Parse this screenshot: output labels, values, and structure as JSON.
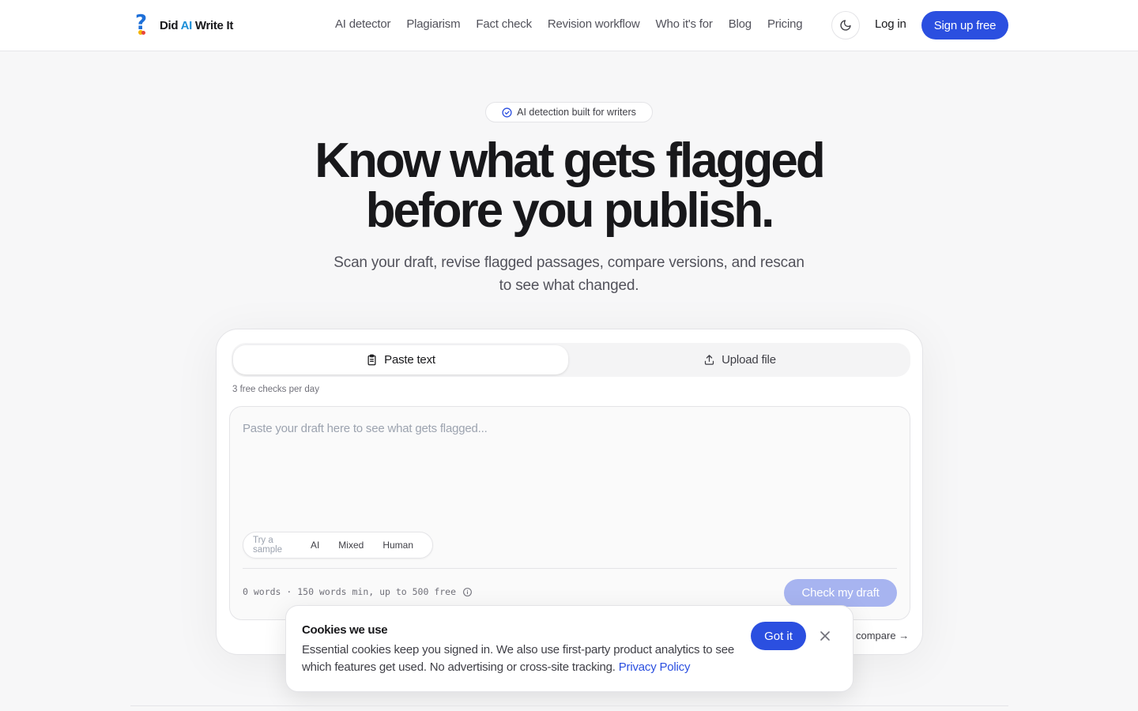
{
  "header": {
    "logo": {
      "part1": "Did ",
      "part2": "AI",
      "part3": " Write It"
    },
    "nav": [
      "AI detector",
      "Plagiarism",
      "Fact check",
      "Revision workflow",
      "Who it's for",
      "Blog",
      "Pricing"
    ],
    "theme_icon": "moon-icon",
    "login_label": "Log in",
    "signup_label": "Sign up free"
  },
  "hero": {
    "badge": "AI detection built for writers",
    "title_line1": "Know what gets flagged",
    "title_line2": "before you publish.",
    "subtitle": "Scan your draft, revise flagged passages, compare versions, and rescan to see what changed."
  },
  "checker": {
    "tabs": [
      {
        "label": "Paste text",
        "icon": "clipboard-icon",
        "active": true
      },
      {
        "label": "Upload file",
        "icon": "upload-icon",
        "active": false
      }
    ],
    "free_note": "3 free checks per day",
    "placeholder": "Paste your draft here to see what gets flagged...",
    "samples": {
      "label": "Try a sample",
      "options": [
        "AI",
        "Mixed",
        "Human"
      ]
    },
    "word_count": "0 words · 150 words min, up to 500 free",
    "check_label": "Check my draft",
    "compare_label": "compare →"
  },
  "cookie": {
    "title": "Cookies we use",
    "body": "Essential cookies keep you signed in. We also use first-party product analytics to see which features get used. No advertising or cross-site tracking. ",
    "policy_link": "Privacy Policy",
    "accept_label": "Got it"
  },
  "colors": {
    "accent": "#2b4fe0",
    "accent_disabled": "#a7b4f0",
    "background": "#f7f7f8"
  }
}
